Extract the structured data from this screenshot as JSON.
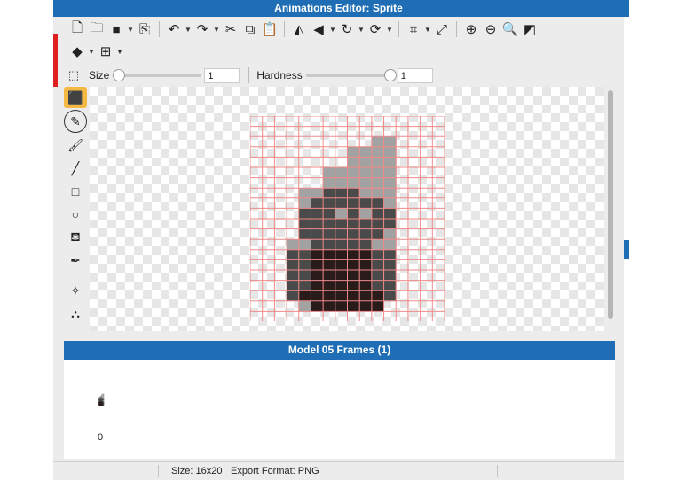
{
  "window": {
    "title": "Animations Editor: Sprite"
  },
  "toolbar": {
    "row1": [
      "file-new-icon",
      "folder-open-icon",
      "save-icon",
      "export-icon",
      "undo-icon",
      "redo-icon",
      "cut-icon",
      "copy-icon",
      "paste-icon",
      "flip-horizontal-icon",
      "flip-vertical-icon",
      "rotate-icon",
      "reload-icon",
      "crop-icon",
      "resize-icon",
      "zoom-in-icon",
      "zoom-out-icon",
      "zoom-fit-icon",
      "color-invert-icon"
    ],
    "row2": [
      "layers-icon",
      "grid-icon"
    ]
  },
  "options": {
    "size_label": "Size",
    "size_value": "1",
    "size_fraction": 0.0,
    "hardness_label": "Hardness",
    "hardness_value": "1",
    "hardness_fraction": 1.0
  },
  "tools": [
    "eraser-icon",
    "pixel-pen-icon",
    "brush-icon",
    "line-icon",
    "rectangle-icon",
    "ellipse-icon",
    "paint-bucket-icon",
    "eyedropper-icon",
    "move-point-icon",
    "node-icon"
  ],
  "canvas": {
    "colors": {
      "grey": "#4a4a4a",
      "dark": "#2a1b1b",
      "light": "#a2a2a2",
      "grid": "#f08a8a"
    },
    "rows": [
      "................",
      "................",
      "..........LL....",
      "........LLLL....",
      "........LLLL....",
      "......LLLLLL....",
      "......LLLLLL....",
      "....LLGGGLLL....",
      "....LGGGGGGL....",
      "....GGGLGLGG....",
      "....GGGGGGGG....",
      "....GGGGGGGL....",
      "...LLGGGGGLL....",
      "...GGDDDDDGG....",
      "...GGDDDDDGG....",
      "...GGDDDDDGG....",
      "...GGDDDDDGG....",
      "...GDDDDDDDG....",
      "....LDDDDDD.....",
      "................"
    ]
  },
  "frames": {
    "title": "Model 05 Frames (1)",
    "index": "0"
  },
  "status": {
    "size": "Size: 16x20",
    "export": "Export Format: PNG"
  }
}
